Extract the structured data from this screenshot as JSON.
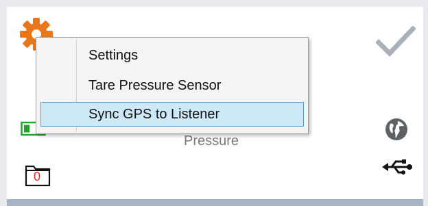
{
  "context_menu": {
    "items": [
      {
        "label": "Settings",
        "highlighted": false
      },
      {
        "label": "Tare Pressure Sensor",
        "highlighted": false
      },
      {
        "label": "Sync GPS to Listener",
        "highlighted": true
      }
    ]
  },
  "card": {
    "pressure_label": "Pressure",
    "folder_badge": "0"
  },
  "icons": {
    "settings": "gear-icon",
    "confirm": "checkmark-icon",
    "battery": "battery-icon",
    "gps": "globe-icon",
    "connection": "usb-icon",
    "folder": "folder-icon"
  },
  "colors": {
    "gear": "#e8761b",
    "checkmark": "#a9b0b8",
    "battery": "#22a32a",
    "folder_badge": "#e0302c",
    "globe": "#5c6166",
    "menu_highlight": "#cde8f7",
    "menu_highlight_border": "#5aa0d6"
  }
}
